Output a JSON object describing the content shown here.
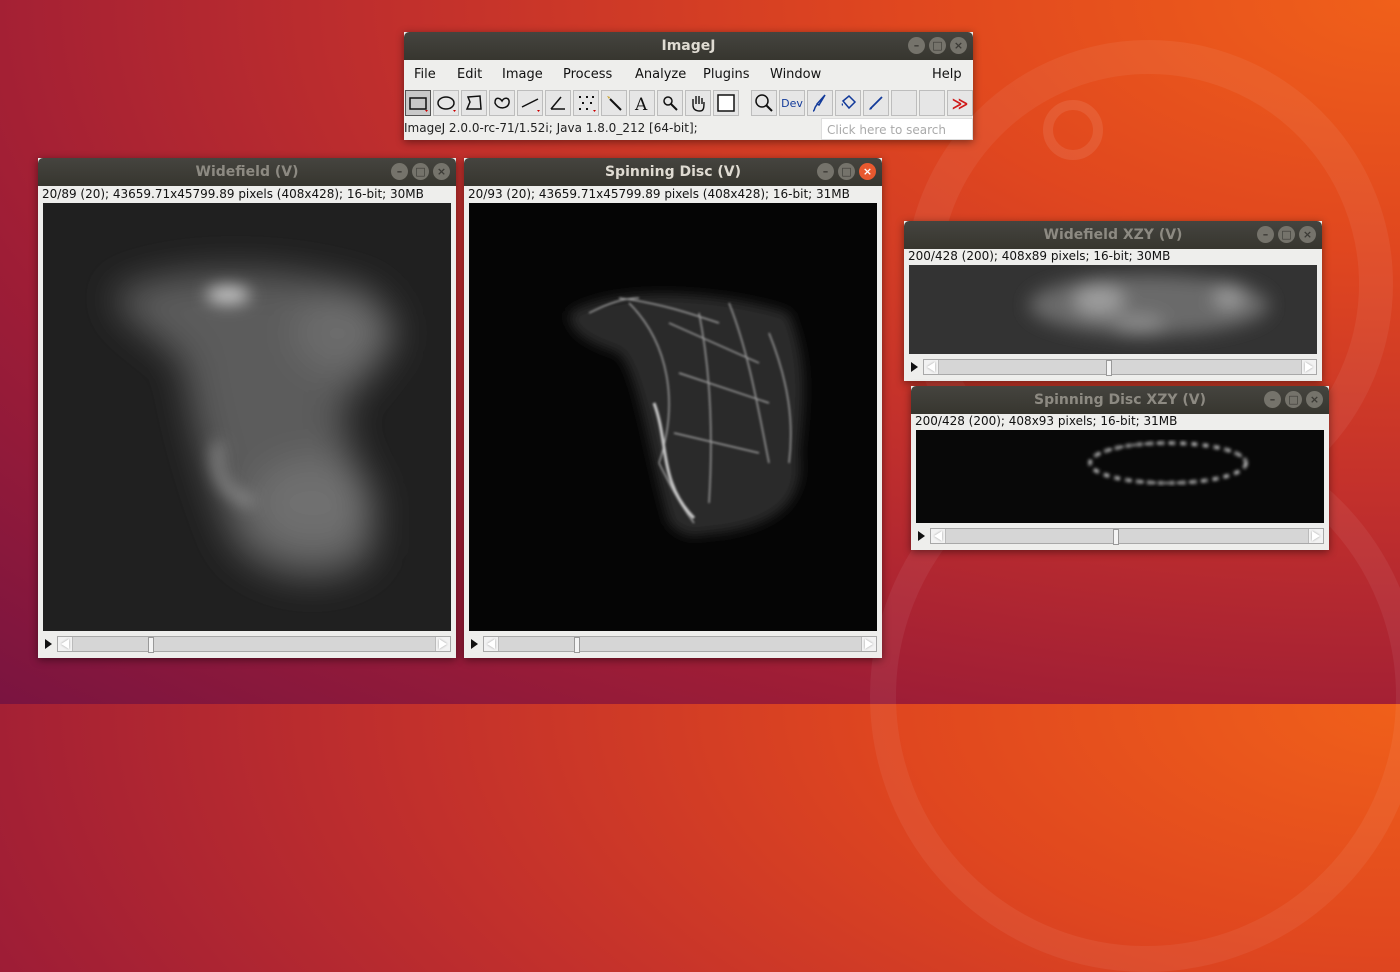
{
  "imagej": {
    "title": "ImageJ",
    "menus": [
      "File",
      "Edit",
      "Image",
      "Process",
      "Analyze",
      "Plugins",
      "Window",
      "Help"
    ],
    "tools": [
      "rectangle-tool",
      "oval-tool",
      "polygon-tool",
      "freehand-tool",
      "line-tool",
      "angle-tool",
      "multipoint-tool",
      "wand-tool",
      "text-tool",
      "zoom-tool",
      "hand-tool",
      "color-picker-tool",
      "magnifier-tool",
      "developer-menu",
      "brush-tool",
      "flood-fill-tool",
      "pencil-tool",
      "empty-slot",
      "empty-slot",
      "more-tools"
    ],
    "dev_label": "Dev",
    "status": "ImageJ 2.0.0-rc-71/1.52i; Java 1.8.0_212 [64-bit];",
    "search_placeholder": "Click here to search"
  },
  "windows": {
    "widefield": {
      "title": "Widefield (V)",
      "info": "20/89 (20); 43659.71x45799.89 pixels (408x428); 16-bit; 30MB",
      "slice_position": 0.21
    },
    "spinning": {
      "title": "Spinning Disc (V)",
      "info": "20/93 (20); 43659.71x45799.89 pixels (408x428); 16-bit; 31MB",
      "slice_position": 0.21
    },
    "widefield_xzy": {
      "title": "Widefield XZY (V)",
      "info": "200/428 (200); 408x89 pixels; 16-bit; 30MB",
      "slice_position": 0.47
    },
    "spinning_xzy": {
      "title": "Spinning Disc XZY (V)",
      "info": "200/428 (200); 408x93 pixels; 16-bit; 31MB",
      "slice_position": 0.47
    }
  },
  "window_buttons": [
    "minimize-icon",
    "maximize-icon",
    "close-icon"
  ]
}
